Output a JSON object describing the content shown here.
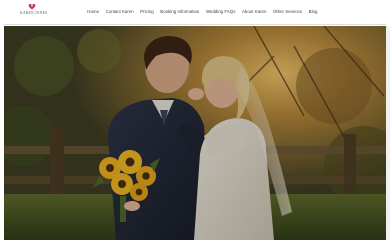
{
  "brand": {
    "name": "KAREN JONES",
    "logo_icon": "heart-flower-icon",
    "accent": "#c0405a"
  },
  "nav": {
    "items": [
      {
        "label": "Home"
      },
      {
        "label": "Contact Karen"
      },
      {
        "label": "Pricing"
      },
      {
        "label": "Booking Information"
      },
      {
        "label": "Wedding FAQs"
      },
      {
        "label": "About Karen"
      },
      {
        "label": "Other Services"
      },
      {
        "label": "Blog"
      }
    ]
  },
  "hero": {
    "image_subject": "wedding-couple-photo"
  }
}
